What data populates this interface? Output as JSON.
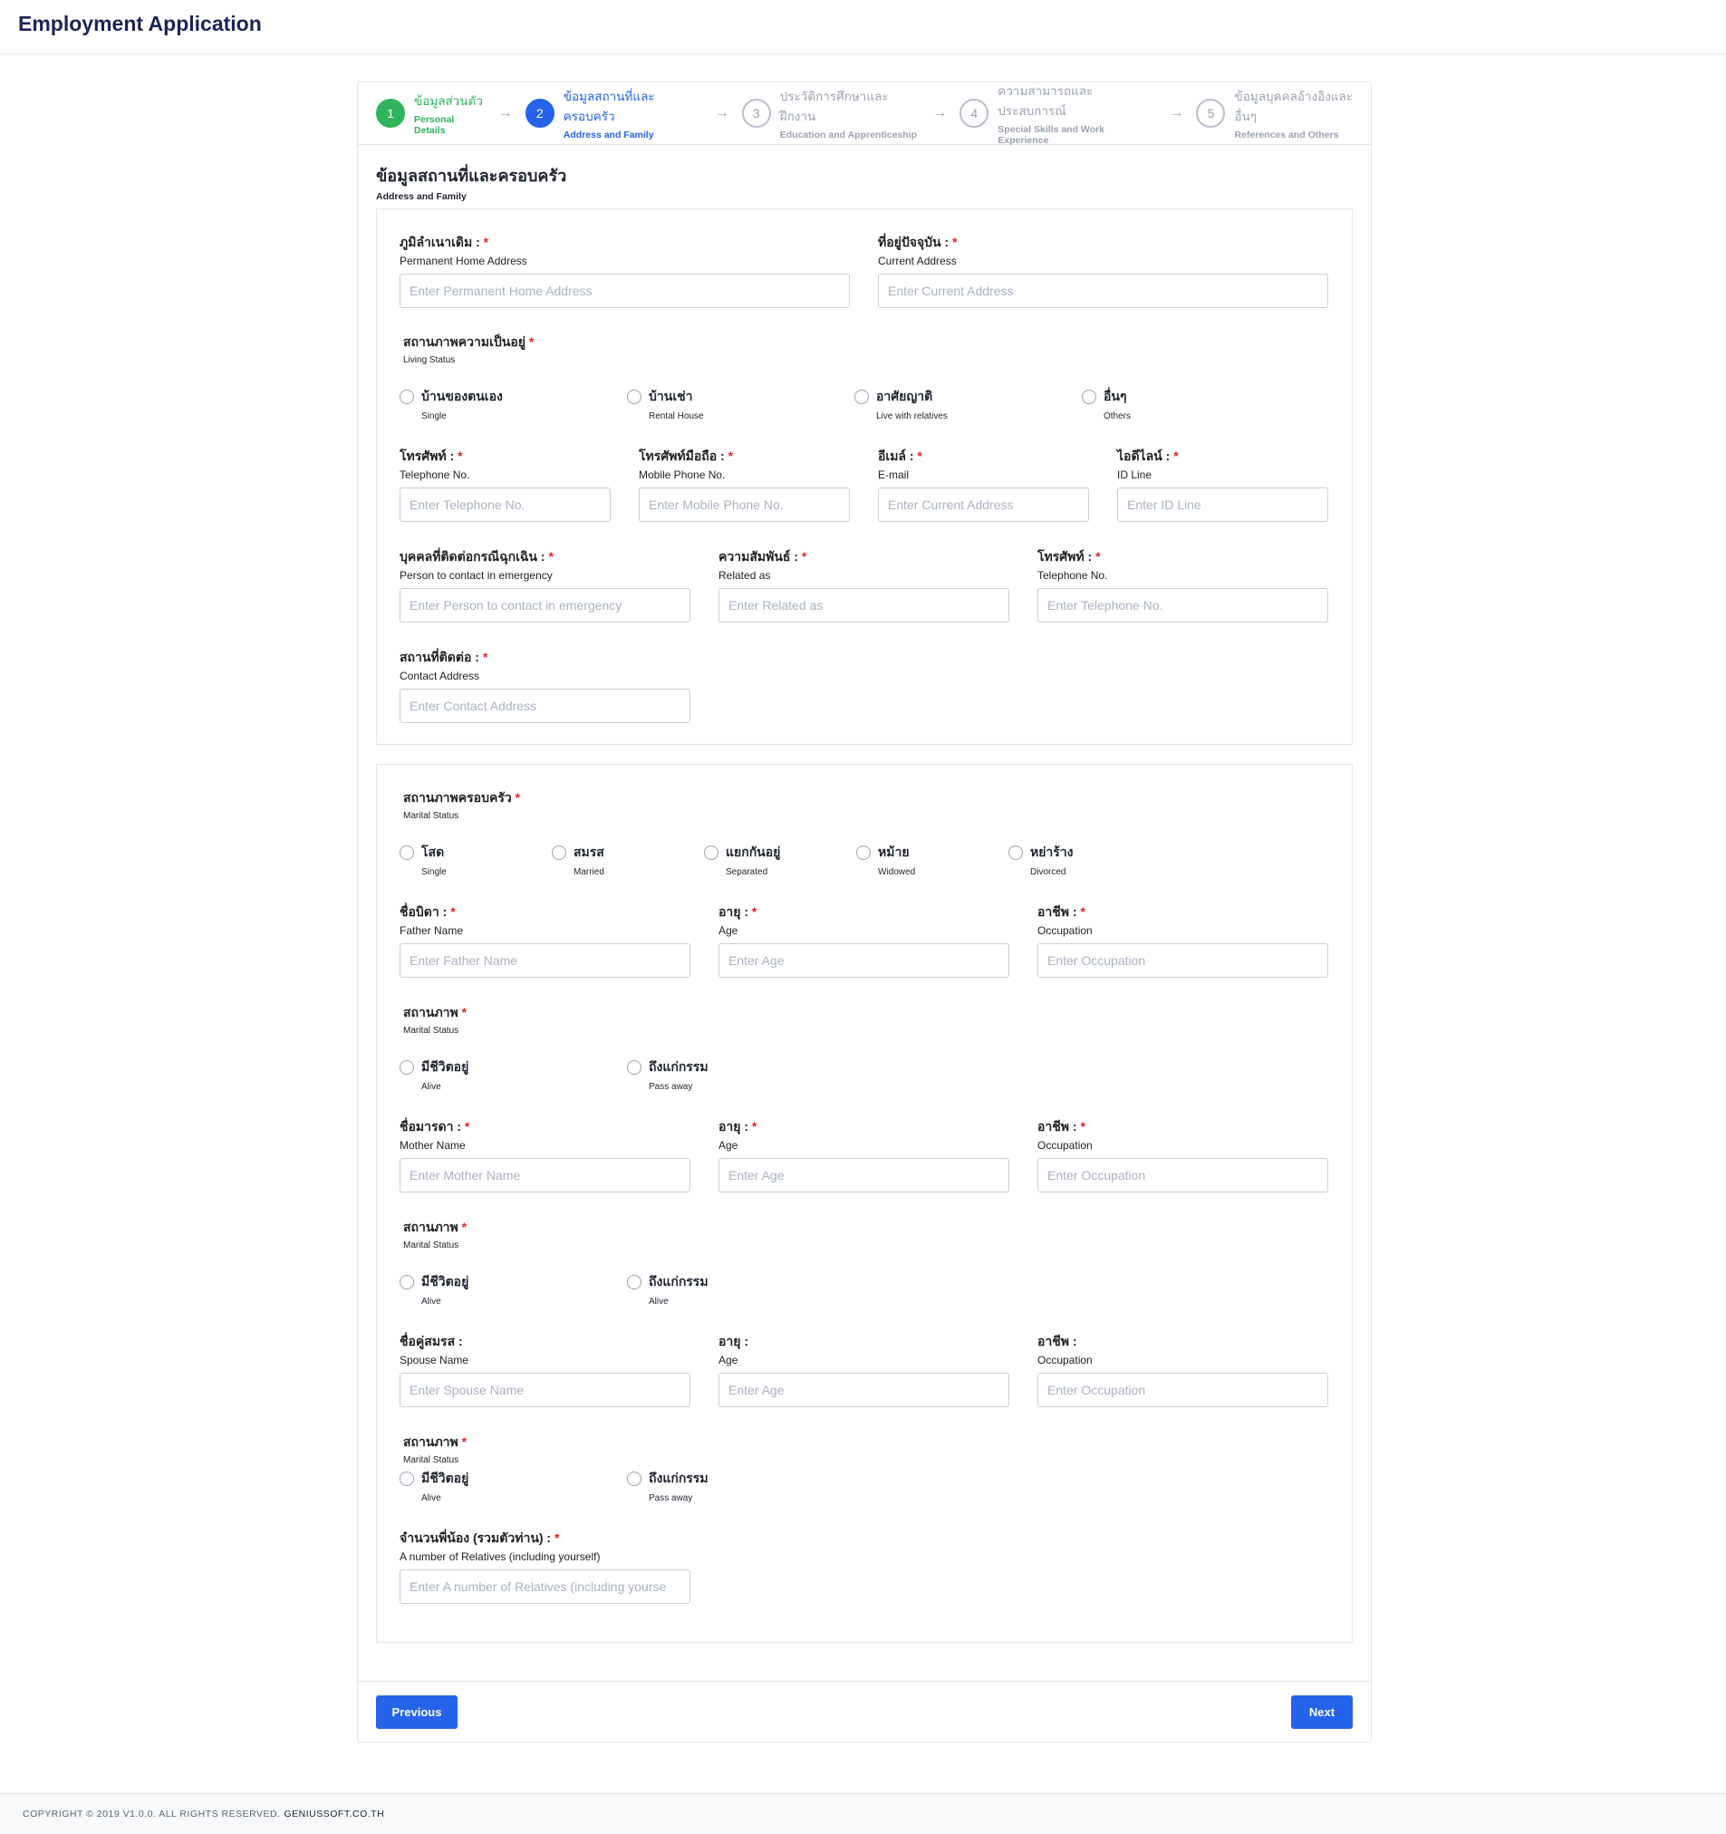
{
  "app": {
    "title": "Employment Application"
  },
  "steps": [
    {
      "num": "1",
      "th": "ข้อมูลส่วนตัว",
      "en": "Personal Details",
      "state": "done"
    },
    {
      "num": "2",
      "th": "ข้อมูลสถานที่และครอบครัว",
      "en": "Address and Family",
      "state": "active"
    },
    {
      "num": "3",
      "th": "ประวัติการศึกษาและฝึกงาน",
      "en": "Education and Apprenticeship",
      "state": "todo"
    },
    {
      "num": "4",
      "th": "ความสามารถและประสบการณ์",
      "en": "Special Skills and Work Experience",
      "state": "todo"
    },
    {
      "num": "5",
      "th": "ข้อมูลบุคคลอ้างอิงและอื่นๆ",
      "en": "References and Others",
      "state": "todo"
    }
  ],
  "section": {
    "title": "ข้อมูลสถานที่และครอบครัว",
    "subtitle": "Address and Family"
  },
  "req": "*",
  "f": {
    "perm": {
      "th": "ภูมิลำเนาเดิม :",
      "en": "Permanent Home Address",
      "ph": "Enter Permanent Home Address"
    },
    "cur": {
      "th": "ที่อยู่ปัจจุบัน :",
      "en": "Current Address",
      "ph": "Enter Current Address"
    },
    "tel": {
      "th": "โทรศัพท์ :",
      "en": "Telephone No.",
      "ph": "Enter Telephone No."
    },
    "mob": {
      "th": "โทรศัพท์มือถือ :",
      "en": "Mobile Phone No.",
      "ph": "Enter Mobile Phone No."
    },
    "email": {
      "th": "อีเมล์ :",
      "en": "E-mail",
      "ph": "Enter Current Address"
    },
    "line": {
      "th": "ไอดีไลน์ :",
      "en": "ID Line",
      "ph": "Enter ID Line"
    },
    "emg": {
      "th": "บุคคลที่ติดต่อกรณีฉุกเฉิน :",
      "en": "Person to contact in emergency",
      "ph": "Enter Person to contact in emergency"
    },
    "rel": {
      "th": "ความสัมพันธ์ :",
      "en": "Related as",
      "ph": "Enter Related as"
    },
    "emgtel": {
      "th": "โทรศัพท์ :",
      "en": "Telephone No.",
      "ph": "Enter Telephone No."
    },
    "contact": {
      "th": "สถานที่ติดต่อ :",
      "en": "Contact Address",
      "ph": "Enter Contact Address"
    },
    "father": {
      "th": "ชื่อบิดา :",
      "en": "Father Name",
      "ph": "Enter Father Name"
    },
    "fage": {
      "th": "อายุ :",
      "en": "Age",
      "ph": "Enter Age"
    },
    "focc": {
      "th": "อาชีพ :",
      "en": "Occupation",
      "ph": "Enter Occupation"
    },
    "mother": {
      "th": "ชื่อมารดา :",
      "en": "Mother Name",
      "ph": "Enter Mother Name"
    },
    "mage": {
      "th": "อายุ :",
      "en": "Age",
      "ph": "Enter Age"
    },
    "mocc": {
      "th": "อาชีพ :",
      "en": "Occupation",
      "ph": "Enter Occupation"
    },
    "spouse": {
      "th": "ชื่อคู่สมรส :",
      "en": "Spouse Name",
      "ph": "Enter Spouse Name"
    },
    "sage": {
      "th": "อายุ :",
      "en": "Age",
      "ph": "Enter Age"
    },
    "socc": {
      "th": "อาชีพ :",
      "en": "Occupation",
      "ph": "Enter Occupation"
    },
    "relatives": {
      "th": "จำนวนพี่น้อง (รวมตัวท่าน) :",
      "en": "A number of Relatives (including yourself)",
      "ph": "Enter A number of Relatives (including yourse"
    }
  },
  "living": {
    "th": "สถานภาพความเป็นอยู่",
    "en": "Living Status",
    "options": [
      {
        "th": "บ้านของตนเอง",
        "en": "Single"
      },
      {
        "th": "บ้านเช่า",
        "en": "Rental House"
      },
      {
        "th": "อาศัยญาติ",
        "en": "Live with relatives"
      },
      {
        "th": "อื่นๆ",
        "en": "Others"
      }
    ]
  },
  "marital": {
    "th": "สถานภาพครอบครัว",
    "en": "Marital Status",
    "options": [
      {
        "th": "โสด",
        "en": "Single"
      },
      {
        "th": "สมรส",
        "en": "Married"
      },
      {
        "th": "แยกกันอยู่",
        "en": "Separated"
      },
      {
        "th": "หม้าย",
        "en": "Widowed"
      },
      {
        "th": "หย่าร้าง",
        "en": "Divorced"
      }
    ]
  },
  "fstatus": {
    "th": "สถานภาพ",
    "en": "Marital Status",
    "options": [
      {
        "th": "มีชีวิตอยู่",
        "en": "Alive"
      },
      {
        "th": "ถึงแก่กรรม",
        "en": "Pass away"
      }
    ]
  },
  "mstatus": {
    "th": "สถานภาพ",
    "en": "Marital Status",
    "options": [
      {
        "th": "มีชีวิตอยู่",
        "en": "Alive"
      },
      {
        "th": "ถึงแก่กรรม",
        "en": "Alive"
      }
    ]
  },
  "sstatus": {
    "th": "สถานภาพ",
    "en": "Marital Status",
    "options": [
      {
        "th": "มีชีวิตอยู่",
        "en": "Alive"
      },
      {
        "th": "ถึงแก่กรรม",
        "en": "Pass away"
      }
    ]
  },
  "buttons": {
    "previous": "Previous",
    "next": "Next"
  },
  "footer": {
    "copyright": "COPYRIGHT © 2019 V1.0.0. ALL RIGHTS RESERVED.",
    "company": "GENIUSSOFT.CO.TH"
  }
}
